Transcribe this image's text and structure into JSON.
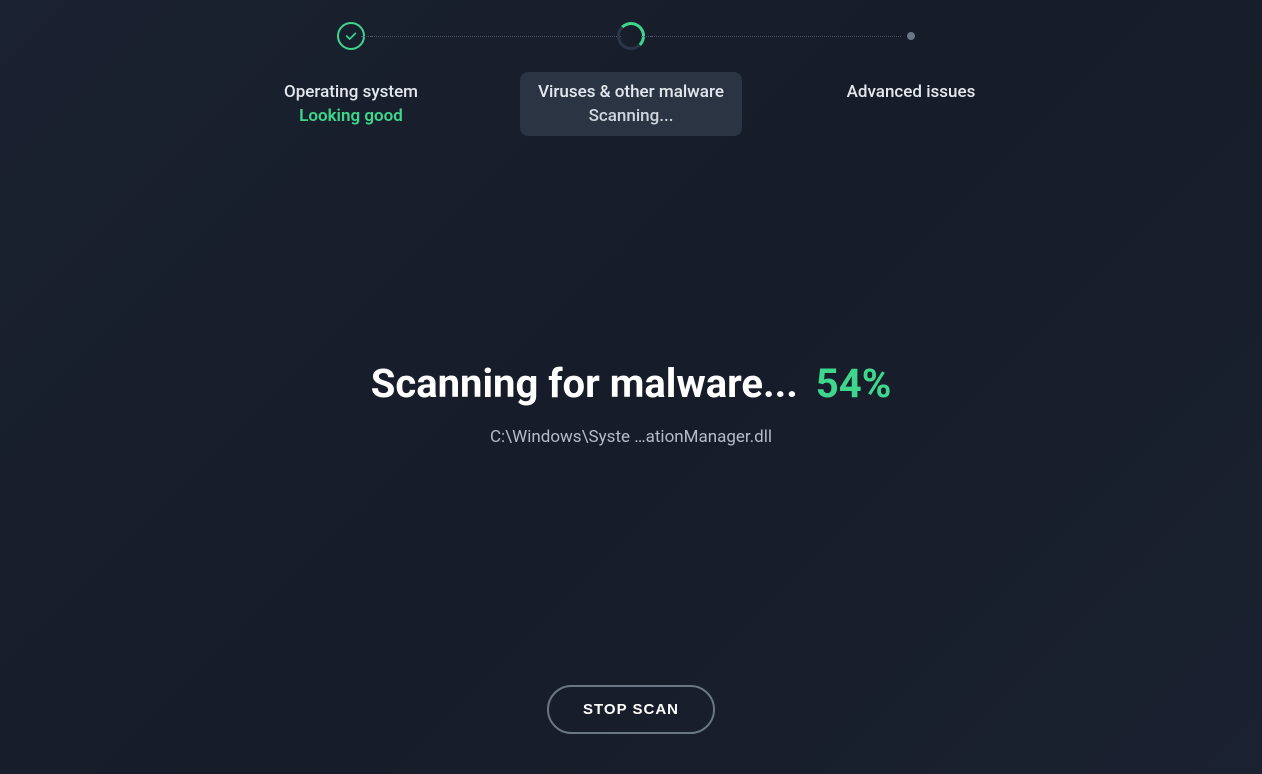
{
  "steps": [
    {
      "title": "Operating system",
      "status": "Looking good"
    },
    {
      "title": "Viruses & other malware",
      "status": "Scanning..."
    },
    {
      "title": "Advanced issues",
      "status": ""
    }
  ],
  "scan": {
    "headline": "Scanning for malware...",
    "percent": "54%",
    "current_file": "C:\\Windows\\Syste  …ationManager.dll"
  },
  "buttons": {
    "stop": "STOP SCAN"
  },
  "colors": {
    "accent": "#3dd68c",
    "bg": "#1a2130"
  }
}
